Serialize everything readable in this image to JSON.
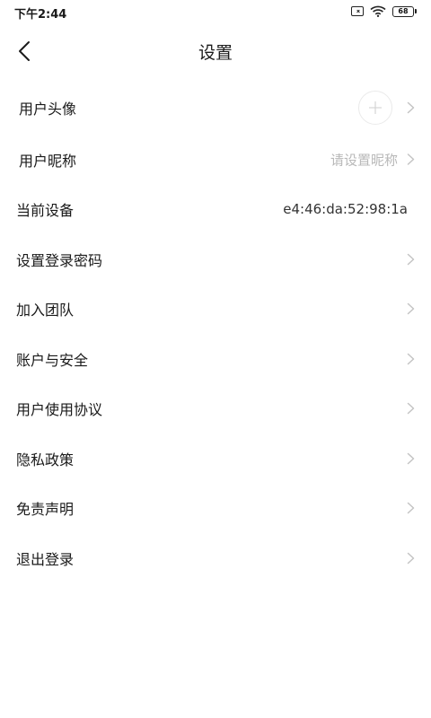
{
  "status_bar": {
    "time": "下午2:44",
    "battery": "68"
  },
  "header": {
    "title": "设置"
  },
  "settings": {
    "avatar_label": "用户头像",
    "nickname_label": "用户昵称",
    "nickname_placeholder": "请设置昵称",
    "device_label": "当前设备",
    "device_value": "e4:46:da:52:98:1a",
    "password_label": "设置登录密码",
    "join_team_label": "加入团队",
    "account_security_label": "账户与安全",
    "user_agreement_label": "用户使用协议",
    "privacy_policy_label": "隐私政策",
    "disclaimer_label": "免责声明",
    "logout_label": "退出登录"
  },
  "colors": {
    "text_primary": "#1a1a1a",
    "text_hint": "#b8b8b8",
    "chevron": "#c4c4c4",
    "background": "#ffffff"
  }
}
